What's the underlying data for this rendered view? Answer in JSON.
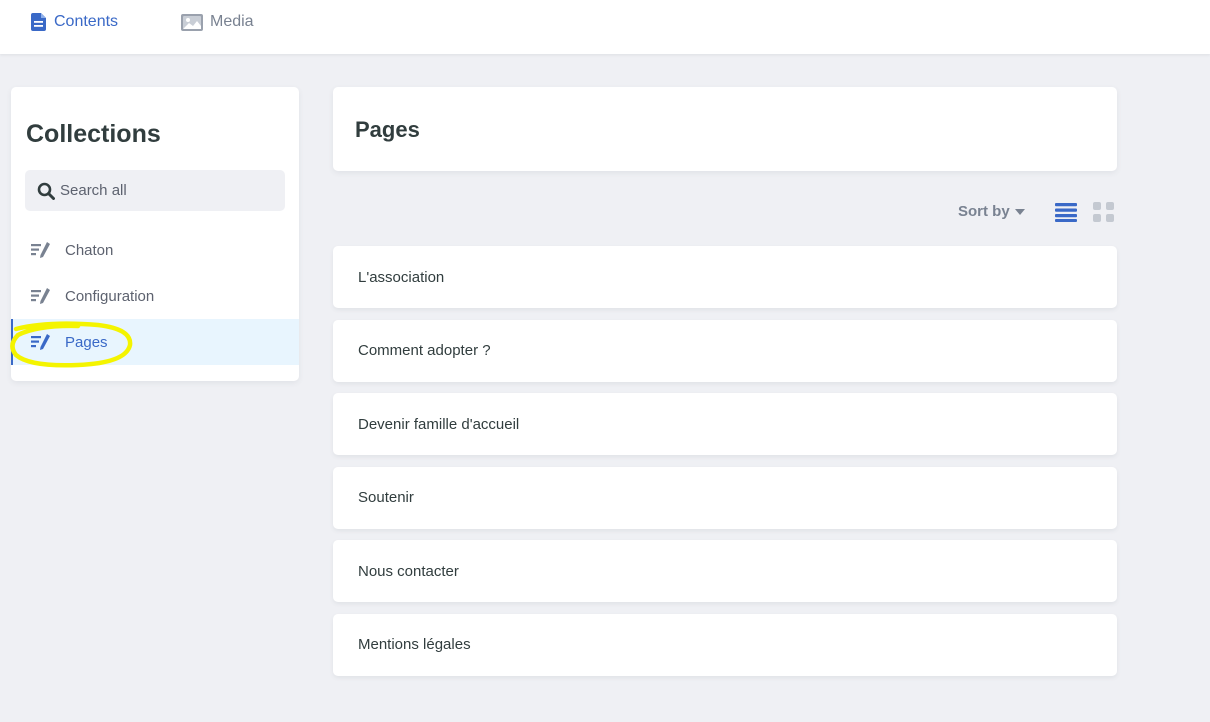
{
  "topbar": {
    "links": [
      {
        "label": "Contents",
        "icon": "document-icon",
        "active": true
      },
      {
        "label": "Media",
        "icon": "image-icon",
        "active": false
      }
    ]
  },
  "sidebar": {
    "title": "Collections",
    "search_placeholder": "Search all",
    "items": [
      {
        "label": "Chaton",
        "icon": "collection-edit-icon",
        "active": false
      },
      {
        "label": "Configuration",
        "icon": "collection-edit-icon",
        "active": false
      },
      {
        "label": "Pages",
        "icon": "collection-edit-icon",
        "active": true
      }
    ]
  },
  "main": {
    "title": "Pages",
    "sort_label": "Sort by",
    "entries": [
      "L'association",
      "Comment adopter ?",
      "Devenir famille d'accueil",
      "Soutenir",
      "Nous contacter",
      "Mentions légales"
    ]
  },
  "colors": {
    "accent": "#3a69c7",
    "background": "#eff0f4",
    "active_item_bg": "#e8f5fe",
    "highlight": "#f4f400"
  }
}
